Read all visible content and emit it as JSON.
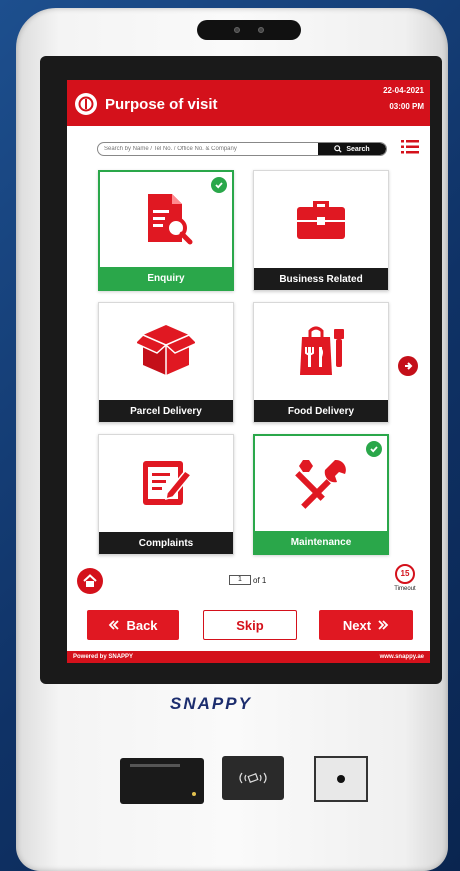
{
  "header": {
    "title": "Purpose of visit",
    "date": "22-04-2021",
    "time": "03:00 PM",
    "accent": "#d4111b"
  },
  "search": {
    "placeholder": "Search by Name / Tel No. / Office No. & Company",
    "button_label": "Search"
  },
  "tiles": [
    {
      "label": "Enquiry",
      "icon": "document-search-icon",
      "selected": true
    },
    {
      "label": "Business Related",
      "icon": "briefcase-icon",
      "selected": false
    },
    {
      "label": "Parcel Delivery",
      "icon": "parcel-box-icon",
      "selected": false
    },
    {
      "label": "Food Delivery",
      "icon": "food-bag-icon",
      "selected": false
    },
    {
      "label": "Complaints",
      "icon": "complaint-form-icon",
      "selected": false
    },
    {
      "label": "Maintenance",
      "icon": "tools-icon",
      "selected": true
    }
  ],
  "pager": {
    "current": "1",
    "of_label": "of 1"
  },
  "timeout": {
    "value": "15",
    "label": "Timeout"
  },
  "buttons": {
    "back": "Back",
    "skip": "Skip",
    "next": "Next"
  },
  "footer": {
    "powered_by": "Powered by",
    "powered_brand": "SNAPPY",
    "url": "www.snappy.ae"
  },
  "device": {
    "brand": "SNAPPY"
  },
  "colors": {
    "selected": "#2aa74a",
    "label_bg": "#1b1b1b"
  }
}
